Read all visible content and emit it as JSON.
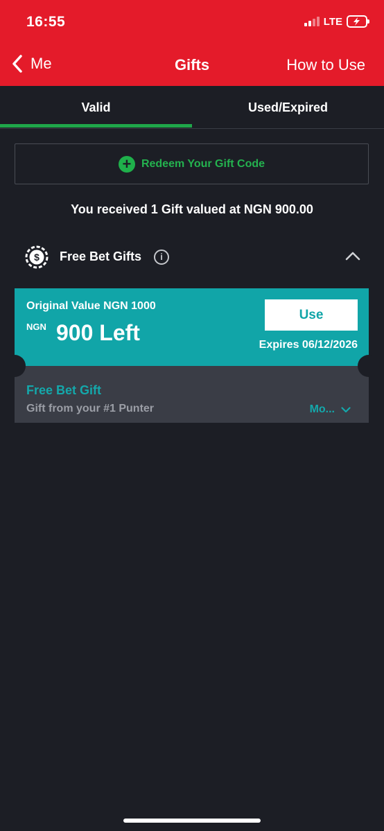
{
  "status_bar": {
    "time": "16:55",
    "network": "LTE"
  },
  "nav": {
    "back_label": "Me",
    "title": "Gifts",
    "right_action": "How to Use"
  },
  "tabs": [
    {
      "label": "Valid",
      "active": true
    },
    {
      "label": "Used/Expired",
      "active": false
    }
  ],
  "redeem": {
    "label": "Redeem Your Gift Code"
  },
  "summary": "You received 1 Gift valued at  NGN 900.00",
  "section": {
    "title": "Free Bet Gifts",
    "info_icon": "info-icon",
    "collapse_icon": "chevron-up-icon"
  },
  "gift_card": {
    "original_value": "Original Value NGN 1000",
    "currency": "NGN",
    "left_amount": "900 Left",
    "use_label": "Use",
    "expires": "Expires 06/12/2026",
    "title": "Free Bet Gift",
    "description": "Gift from your #1 Punter",
    "more_label": "Mo..."
  },
  "colors": {
    "header": "#e41b2a",
    "background": "#1c1e25",
    "accent_green": "#1fa64a",
    "card_teal": "#11a5a8",
    "card_bottom": "#3a3d46"
  }
}
